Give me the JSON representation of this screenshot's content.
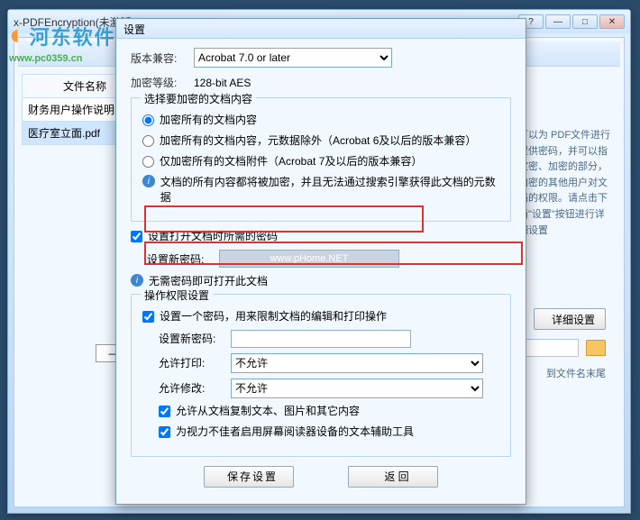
{
  "watermark": {
    "site": "河东软件网",
    "url": "www.pc0359.cn"
  },
  "mainWindow": {
    "title": "x-PDFEncryption(未激活)",
    "fileHeader": "文件名称",
    "files": [
      "财务用户操作说明",
      "医疗室立面.pdf"
    ]
  },
  "rightPanel": {
    "desc": "可以为 PDF文件进行提供密码，并可以指定密、加密的部分，加密的其他用户对文档的权限。请点击下面\"设置\"按钮进行详细设置",
    "detailBtn": "详细设置",
    "appendLabel": "到文件名末尾"
  },
  "dialog": {
    "title": "设置",
    "compatLabel": "版本兼容:",
    "compatValue": "Acrobat 7.0 or later",
    "encLevelLabel": "加密等级:",
    "encLevelValue": "128-bit AES",
    "fs1": {
      "legend": "选择要加密的文档内容",
      "r1": "加密所有的文档内容",
      "r2": "加密所有的文档内容，元数据除外（Acrobat 6及以后的版本兼容）",
      "r3": "仅加密所有的文档附件（Acrobat 7及以后的版本兼容）",
      "info": "文档的所有内容都将被加密，并且无法通过搜索引擎获得此文档的元数据"
    },
    "openPw": {
      "check": "设置打开文档时所需的密码",
      "label": "设置新密码:",
      "placeholder": "www.pHome.NET",
      "noPw": "无需密码即可打开此文档"
    },
    "perm": {
      "legend": "操作权限设置",
      "check": "设置一个密码，用来限制文档的编辑和打印操作",
      "pwLabel": "设置新密码:",
      "printLabel": "允许打印:",
      "printValue": "不允许",
      "modifyLabel": "允许修改:",
      "modifyValue": "不允许",
      "copyCheck": "允许从文档复制文本、图片和其它内容",
      "accessCheck": "为视力不佳者启用屏幕阅读器设备的文本辅助工具"
    },
    "saveBtn": "保存设置",
    "backBtn": "返   回"
  }
}
